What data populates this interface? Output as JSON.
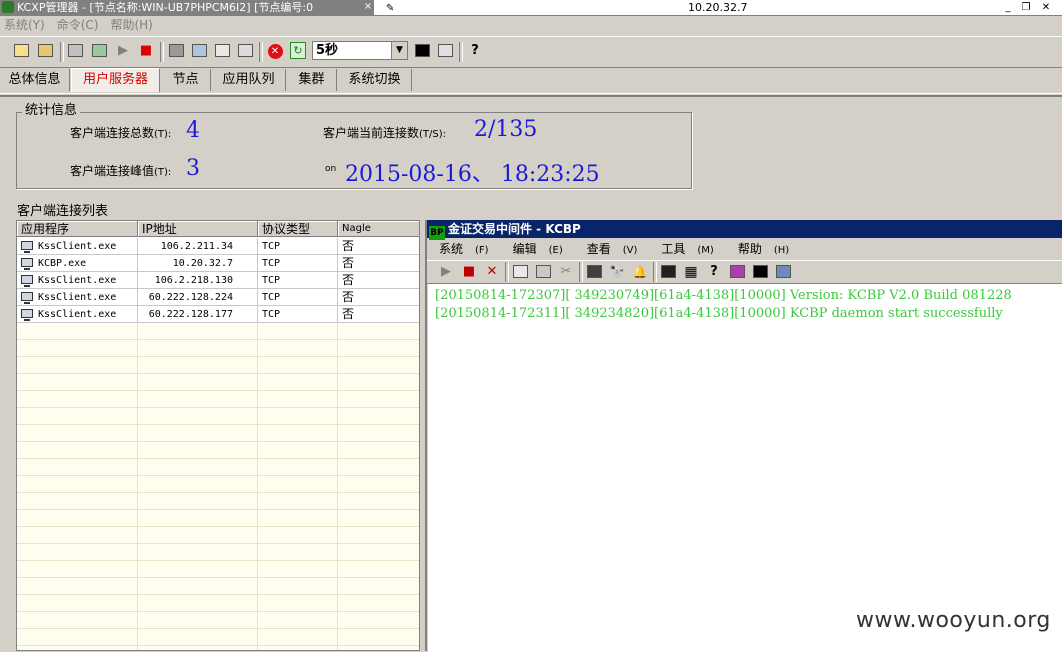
{
  "title_bar": {
    "main_title": "KCXP管理器 - [节点名称:WIN-UB7PHPCM6I2] [节点编号:0",
    "address": "10.20.32.7",
    "close_tab": "×",
    "pin": "✎",
    "minimize": "_",
    "restore": "❐",
    "close": "✕"
  },
  "menu": [
    {
      "label": "系统(Y)"
    },
    {
      "label": "命令(C)"
    },
    {
      "label": "帮助(H)"
    }
  ],
  "toolbar": {
    "interval": "5秒",
    "interval_arrow": "▼",
    "play": "▶",
    "stop": "■",
    "help": "?",
    "refresh": "↻",
    "red_stop": "✕"
  },
  "tabs": [
    {
      "label": "总体信息"
    },
    {
      "label": "用户服务器"
    },
    {
      "label": "节点"
    },
    {
      "label": "应用队列"
    },
    {
      "label": "集群"
    },
    {
      "label": "系统切换"
    }
  ],
  "stats": {
    "legend": "统计信息",
    "total_label": "客户端连接总数",
    "total_hotkey": "(T):",
    "total_value": "4",
    "current_label": "客户端当前连接数",
    "current_hotkey": "(T/S):",
    "current_value": "2/135",
    "peak_label": "客户端连接峰值",
    "peak_hotkey": "(T):",
    "peak_value": "3",
    "on_label": "on",
    "peak_time": "2015-08-16、 18:23:25"
  },
  "client_list": {
    "caption": "客户端连接列表",
    "columns": [
      "应用程序",
      "IP地址",
      "协议类型",
      "Nagle"
    ],
    "rows": [
      {
        "app": "KssClient.exe",
        "ip": "106.2.211.34",
        "protocol": "TCP",
        "nagle": "否"
      },
      {
        "app": "KCBP.exe",
        "ip": "10.20.32.7",
        "protocol": "TCP",
        "nagle": "否"
      },
      {
        "app": "KssClient.exe",
        "ip": "106.2.218.130",
        "protocol": "TCP",
        "nagle": "否"
      },
      {
        "app": "KssClient.exe",
        "ip": "60.222.128.224",
        "protocol": "TCP",
        "nagle": "否"
      },
      {
        "app": "KssClient.exe",
        "ip": "60.222.128.177",
        "protocol": "TCP",
        "nagle": "否"
      }
    ]
  },
  "console": {
    "badge": "BP",
    "title": "金证交易中间件 - KCBP",
    "menu": [
      {
        "label": "系统",
        "hotkey": "(F)"
      },
      {
        "label": "编辑",
        "hotkey": "(E)"
      },
      {
        "label": "查看",
        "hotkey": "(V)"
      },
      {
        "label": "工具",
        "hotkey": "(M)"
      },
      {
        "label": "帮助",
        "hotkey": "(H)"
      }
    ],
    "toolbar": {
      "play": "▶",
      "stop": "■",
      "delete": "✕",
      "cut": "✂",
      "find": "🔭",
      "bell": "🔔",
      "help": "?",
      "grid": "▦"
    },
    "log": [
      "[20150814-172307][   349230749][61a4-4138][10000] Version: KCBP V2.0 Build 081228",
      "[20150814-172311][   349234820][61a4-4138][10000] KCBP daemon start successfully"
    ]
  },
  "watermark": "www.wooyun.org",
  "colors": {
    "accent_blue": "#1a1ad6",
    "active_tab": "#d40000",
    "log_green": "#3ac83a",
    "console_title": "#0a246a"
  }
}
